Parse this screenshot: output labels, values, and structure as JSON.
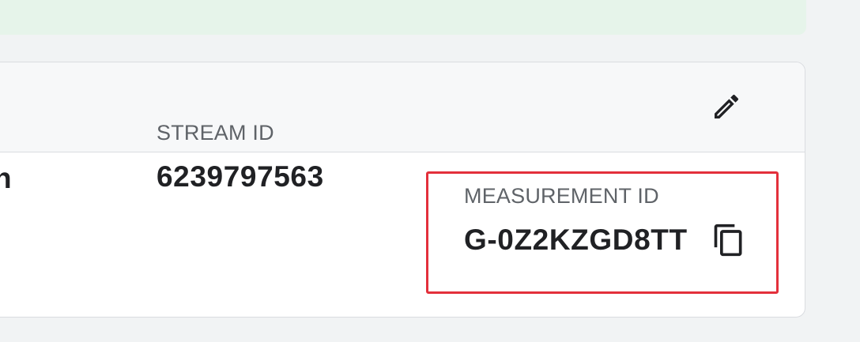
{
  "stream": {
    "partial_value": "n",
    "stream_id_label": "STREAM ID",
    "stream_id_value": "6239797563",
    "measurement_id_label": "MEASUREMENT ID",
    "measurement_id_value": "G-0Z2KZGD8TT"
  },
  "icons": {
    "edit": "pencil-icon",
    "copy": "copy-icon"
  },
  "colors": {
    "banner_bg": "#e6f4ea",
    "header_bg": "#f7f8f9",
    "highlight": "#e3303b",
    "text_primary": "#202124",
    "text_secondary": "#5f6368"
  }
}
